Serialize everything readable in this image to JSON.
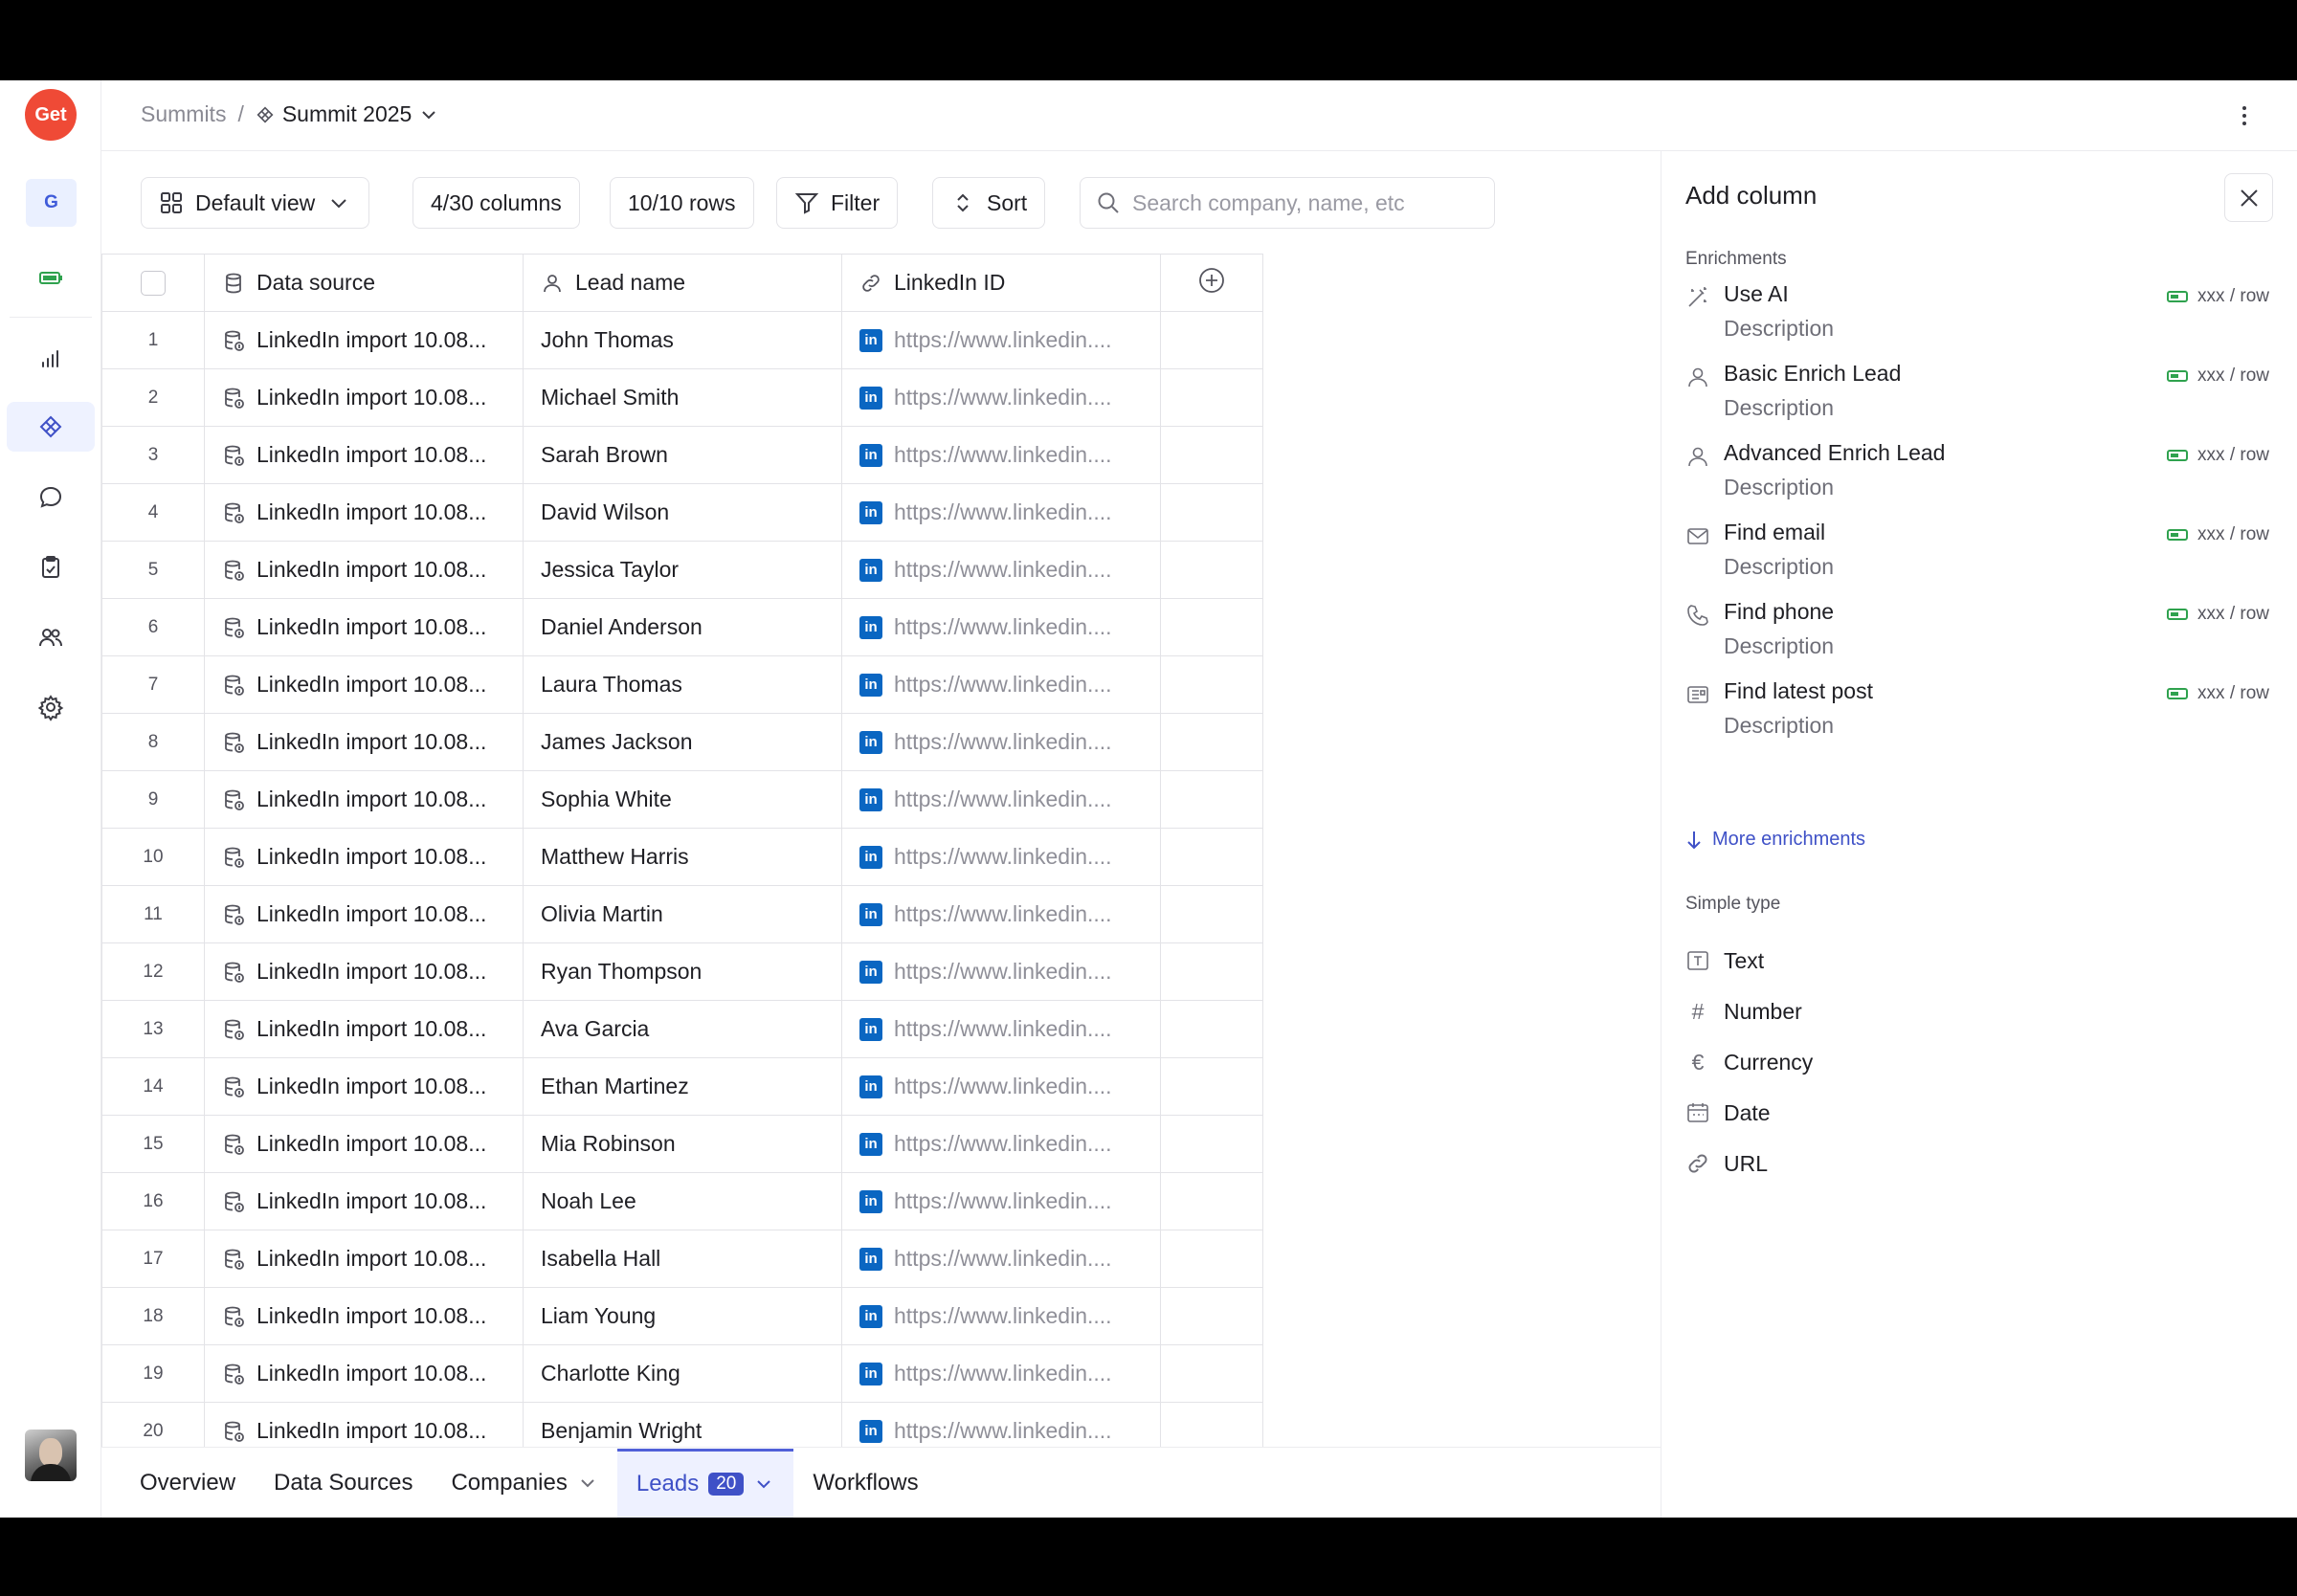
{
  "rail": {
    "logo": "Get",
    "workspace": "G",
    "icons": [
      "battery-icon",
      "chart-icon",
      "diamond-icon",
      "chat-icon",
      "clipboard-icon",
      "users-icon",
      "gear-icon"
    ]
  },
  "breadcrumb": {
    "parent": "Summits",
    "separator": "/",
    "current": "Summit 2025"
  },
  "toolbar": {
    "view": "Default view",
    "columns": "4/30 columns",
    "rows": "10/10 rows",
    "filter": "Filter",
    "sort": "Sort",
    "search_placeholder": "Search company, name, etc"
  },
  "table": {
    "headers": {
      "data_source": "Data source",
      "lead_name": "Lead name",
      "linkedin": "LinkedIn ID"
    },
    "rows": [
      {
        "n": "1",
        "source": "LinkedIn import 10.08...",
        "name": "John Thomas",
        "url": "https://www.linkedin...."
      },
      {
        "n": "2",
        "source": "LinkedIn import 10.08...",
        "name": "Michael Smith",
        "url": "https://www.linkedin...."
      },
      {
        "n": "3",
        "source": "LinkedIn import 10.08...",
        "name": "Sarah Brown",
        "url": "https://www.linkedin...."
      },
      {
        "n": "4",
        "source": "LinkedIn import 10.08...",
        "name": "David Wilson",
        "url": "https://www.linkedin...."
      },
      {
        "n": "5",
        "source": "LinkedIn import 10.08...",
        "name": "Jessica Taylor",
        "url": "https://www.linkedin...."
      },
      {
        "n": "6",
        "source": "LinkedIn import 10.08...",
        "name": "Daniel Anderson",
        "url": "https://www.linkedin...."
      },
      {
        "n": "7",
        "source": "LinkedIn import 10.08...",
        "name": "Laura Thomas",
        "url": "https://www.linkedin...."
      },
      {
        "n": "8",
        "source": "LinkedIn import 10.08...",
        "name": "James Jackson",
        "url": "https://www.linkedin...."
      },
      {
        "n": "9",
        "source": "LinkedIn import 10.08...",
        "name": "Sophia White",
        "url": "https://www.linkedin...."
      },
      {
        "n": "10",
        "source": "LinkedIn import 10.08...",
        "name": "Matthew Harris",
        "url": "https://www.linkedin...."
      },
      {
        "n": "11",
        "source": "LinkedIn import 10.08...",
        "name": "Olivia Martin",
        "url": "https://www.linkedin...."
      },
      {
        "n": "12",
        "source": "LinkedIn import 10.08...",
        "name": "Ryan Thompson",
        "url": "https://www.linkedin...."
      },
      {
        "n": "13",
        "source": "LinkedIn import 10.08...",
        "name": "Ava Garcia",
        "url": "https://www.linkedin...."
      },
      {
        "n": "14",
        "source": "LinkedIn import 10.08...",
        "name": "Ethan Martinez",
        "url": "https://www.linkedin...."
      },
      {
        "n": "15",
        "source": "LinkedIn import 10.08...",
        "name": "Mia Robinson",
        "url": "https://www.linkedin...."
      },
      {
        "n": "16",
        "source": "LinkedIn import 10.08...",
        "name": "Noah Lee",
        "url": "https://www.linkedin...."
      },
      {
        "n": "17",
        "source": "LinkedIn import 10.08...",
        "name": "Isabella Hall",
        "url": "https://www.linkedin...."
      },
      {
        "n": "18",
        "source": "LinkedIn import 10.08...",
        "name": "Liam Young",
        "url": "https://www.linkedin...."
      },
      {
        "n": "19",
        "source": "LinkedIn import 10.08...",
        "name": "Charlotte King",
        "url": "https://www.linkedin...."
      },
      {
        "n": "20",
        "source": "LinkedIn import 10.08...",
        "name": "Benjamin Wright",
        "url": "https://www.linkedin...."
      }
    ]
  },
  "bottom_tabs": {
    "overview": "Overview",
    "data_sources": "Data Sources",
    "companies": "Companies",
    "leads": "Leads",
    "leads_count": "20",
    "workflows": "Workflows"
  },
  "panel": {
    "title": "Add column",
    "enrichments_label": "Enrichments",
    "enrichments": [
      {
        "name": "Use AI",
        "desc": "Description",
        "cost": "xxx / row",
        "icon": "magic-wand-icon"
      },
      {
        "name": "Basic Enrich Lead",
        "desc": "Description",
        "cost": "xxx / row",
        "icon": "person-icon"
      },
      {
        "name": "Advanced Enrich Lead",
        "desc": "Description",
        "cost": "xxx / row",
        "icon": "person-icon"
      },
      {
        "name": "Find email",
        "desc": "Description",
        "cost": "xxx / row",
        "icon": "envelope-icon"
      },
      {
        "name": "Find phone",
        "desc": "Description",
        "cost": "xxx / row",
        "icon": "phone-icon"
      },
      {
        "name": "Find latest post",
        "desc": "Description",
        "cost": "xxx / row",
        "icon": "newspaper-icon"
      }
    ],
    "more_enrichments": "More enrichments",
    "simple_label": "Simple type",
    "simple_types": [
      {
        "name": "Text",
        "glyph": "T",
        "icon": "text-icon"
      },
      {
        "name": "Number",
        "glyph": "#",
        "icon": "hash-icon"
      },
      {
        "name": "Currency",
        "glyph": "€",
        "icon": "euro-icon"
      },
      {
        "name": "Date",
        "glyph": "",
        "icon": "calendar-icon"
      },
      {
        "name": "URL",
        "glyph": "",
        "icon": "link-icon"
      }
    ]
  },
  "colors": {
    "accent": "#3f51c7",
    "logo": "#ef4a36",
    "battery": "#2fa24e",
    "linkedin": "#0a66c2"
  }
}
